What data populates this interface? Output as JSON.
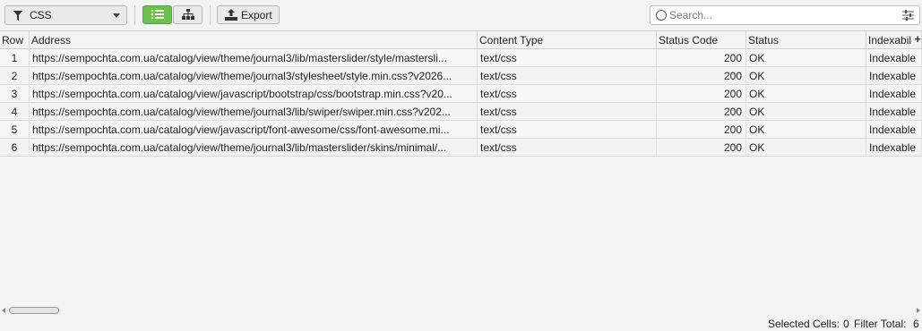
{
  "toolbar": {
    "filter_value": "CSS",
    "export_label": "Export",
    "search_placeholder": "Search...",
    "active_view": "list",
    "accent_color": "#6ac24a"
  },
  "table": {
    "columns": [
      "Row",
      "Address",
      "Content Type",
      "Status Code",
      "Status",
      "Indexabil"
    ],
    "add_column_symbol": "+",
    "rows": [
      {
        "row": "1",
        "address": "https://sempochta.com.ua/catalog/view/theme/journal3/lib/masterslider/style/mastersli...",
        "content_type": "text/css",
        "status_code": "200",
        "status": "OK",
        "indexability": "Indexable"
      },
      {
        "row": "2",
        "address": "https://sempochta.com.ua/catalog/view/theme/journal3/stylesheet/style.min.css?v2026...",
        "content_type": "text/css",
        "status_code": "200",
        "status": "OK",
        "indexability": "Indexable"
      },
      {
        "row": "3",
        "address": "https://sempochta.com.ua/catalog/view/javascript/bootstrap/css/bootstrap.min.css?v20...",
        "content_type": "text/css",
        "status_code": "200",
        "status": "OK",
        "indexability": "Indexable"
      },
      {
        "row": "4",
        "address": "https://sempochta.com.ua/catalog/view/theme/journal3/lib/swiper/swiper.min.css?v202...",
        "content_type": "text/css",
        "status_code": "200",
        "status": "OK",
        "indexability": "Indexable"
      },
      {
        "row": "5",
        "address": "https://sempochta.com.ua/catalog/view/javascript/font-awesome/css/font-awesome.mi...",
        "content_type": "text/css",
        "status_code": "200",
        "status": "OK",
        "indexability": "Indexable"
      },
      {
        "row": "6",
        "address": "https://sempochta.com.ua/catalog/view/theme/journal3/lib/masterslider/skins/minimal/...",
        "content_type": "text/css",
        "status_code": "200",
        "status": "OK",
        "indexability": "Indexable"
      }
    ]
  },
  "statusbar": {
    "selected_cells_label": "Selected Cells:",
    "selected_cells_value": "0",
    "filter_total_label": "Filter Total:",
    "filter_total_value": "6"
  }
}
